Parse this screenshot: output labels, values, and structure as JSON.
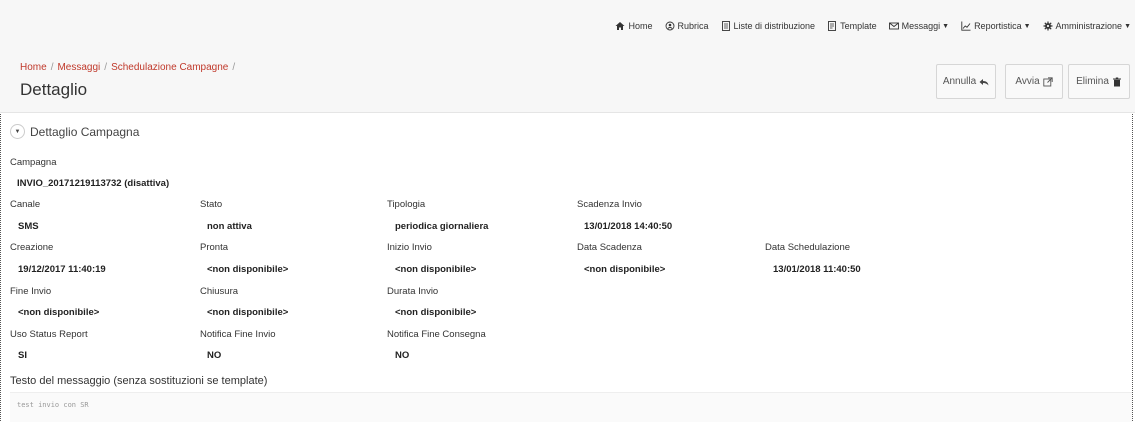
{
  "nav": {
    "items": [
      {
        "label": "Home",
        "icon": "home-icon"
      },
      {
        "label": "Rubrica",
        "icon": "address-book-icon"
      },
      {
        "label": "Liste di distribuzione",
        "icon": "list-document-icon"
      },
      {
        "label": "Template",
        "icon": "template-document-icon"
      },
      {
        "label": "Messaggi",
        "icon": "envelope-icon",
        "dropdown": true
      },
      {
        "label": "Reportistica",
        "icon": "line-chart-icon",
        "dropdown": true
      },
      {
        "label": "Amministrazione",
        "icon": "gear-icon",
        "dropdown": true
      }
    ]
  },
  "breadcrumb": {
    "home": "Home",
    "messaggi": "Messaggi",
    "schedulazione": "Schedulazione Campagne",
    "sep": "/"
  },
  "page_title": "Dettaglio",
  "actions": {
    "annulla": "Annulla",
    "avvia": "Avvia",
    "elimina": "Elimina"
  },
  "section": {
    "title": "Dettaglio Campagna"
  },
  "fields": {
    "campagna": {
      "label": "Campagna",
      "value": "INVIO_20171219113732 (disattiva)"
    },
    "canale": {
      "label": "Canale",
      "value": "SMS"
    },
    "stato": {
      "label": "Stato",
      "value": "non attiva"
    },
    "tipologia": {
      "label": "Tipologia",
      "value": "periodica giornaliera"
    },
    "scadenza_invio": {
      "label": "Scadenza Invio",
      "value": "13/01/2018 14:40:50"
    },
    "creazione": {
      "label": "Creazione",
      "value": "19/12/2017 11:40:19"
    },
    "pronta": {
      "label": "Pronta",
      "value": "<non disponibile>"
    },
    "inizio_invio": {
      "label": "Inizio Invio",
      "value": "<non disponibile>"
    },
    "data_scadenza": {
      "label": "Data Scadenza",
      "value": "<non disponibile>"
    },
    "data_schedulazione": {
      "label": "Data Schedulazione",
      "value": "13/01/2018 11:40:50"
    },
    "fine_invio": {
      "label": "Fine Invio",
      "value": "<non disponibile>"
    },
    "chiusura": {
      "label": "Chiusura",
      "value": "<non disponibile>"
    },
    "durata_invio": {
      "label": "Durata Invio",
      "value": "<non disponibile>"
    },
    "uso_status_report": {
      "label": "Uso Status Report",
      "value": "SI"
    },
    "notifica_fine_invio": {
      "label": "Notifica Fine Invio",
      "value": "NO"
    },
    "notifica_fine_consegna": {
      "label": "Notifica Fine Consegna",
      "value": "NO"
    }
  },
  "message": {
    "label": "Testo del messaggio (senza sostituzioni se template)",
    "text": "test invio con SR"
  },
  "colors": {
    "breadcrumb": "#c0392b",
    "header_bg": "#f7f7f7"
  }
}
